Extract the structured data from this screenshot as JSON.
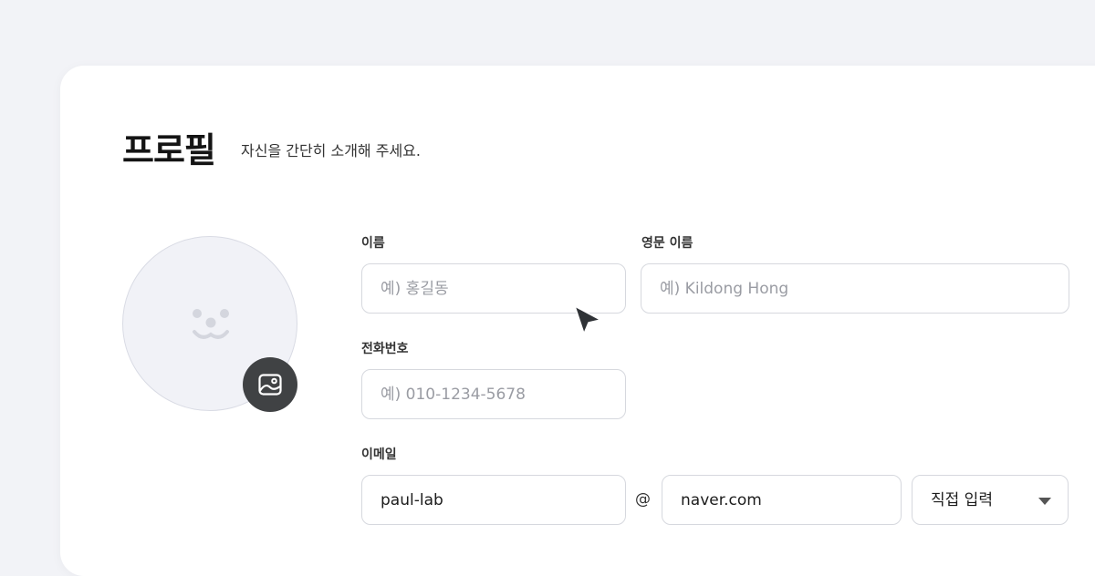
{
  "header": {
    "title": "프로필",
    "subtitle": "자신을 간단히 소개해 주세요."
  },
  "avatar": {
    "placeholder_icon": "smile-face-icon",
    "upload_icon": "image-icon"
  },
  "form": {
    "name": {
      "label": "이름",
      "placeholder": "예) 홍길동",
      "value": ""
    },
    "english_name": {
      "label": "영문 이름",
      "placeholder": "예) Kildong Hong",
      "value": ""
    },
    "phone": {
      "label": "전화번호",
      "placeholder": "예) 010-1234-5678",
      "value": ""
    },
    "email": {
      "label": "이메일",
      "local_part": "paul-lab",
      "at": "@",
      "domain": "naver.com",
      "domain_select": {
        "selected": "직접 입력",
        "icon": "caret-down-icon"
      }
    }
  },
  "colors": {
    "background": "#f2f3f7",
    "card": "#ffffff",
    "input_border": "#d6d8de",
    "avatar_fill": "#f1f2f7",
    "upload_button": "#404244",
    "placeholder_text": "#9a9ca3"
  }
}
